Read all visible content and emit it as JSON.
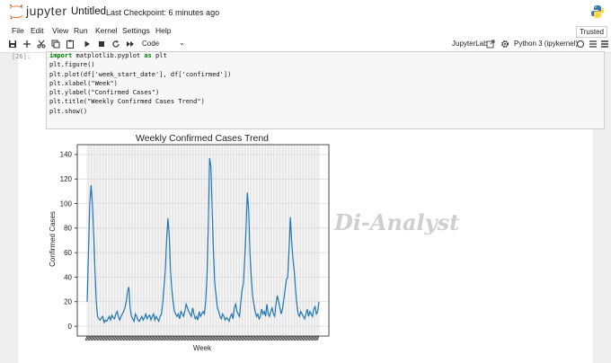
{
  "header": {
    "logo_text": "jupyter",
    "notebook_title": "Untitled",
    "checkpoint": "Last Checkpoint: 6 minutes ago"
  },
  "menu": {
    "items": [
      "File",
      "Edit",
      "View",
      "Run",
      "Kernel",
      "Settings",
      "Help"
    ],
    "trusted": "Trusted"
  },
  "toolbar": {
    "icons": [
      "save-icon",
      "add-cell-icon",
      "cut-icon",
      "copy-icon",
      "paste-icon",
      "run-icon",
      "stop-icon",
      "restart-icon",
      "fast-forward-icon"
    ],
    "cell_type": "Code",
    "jupyterlab_label": "JupyterLab",
    "kernel_name": "Python 3 (ipykernel)"
  },
  "cell": {
    "prompt": "[26]:",
    "code_lines": [
      "import matplotlib.pyplot as plt",
      "",
      "plt.figure()",
      "plt.plot(df['week_start_date'], df['confirmed'])",
      "plt.xlabel(\"Week\")",
      "plt.ylabel(\"Confirmed Cases\")",
      "plt.title(\"Weekly Confirmed Cases Trend\")",
      "plt.show()"
    ]
  },
  "watermark": "Di-Analyst",
  "chart_data": {
    "type": "line",
    "title": "Weekly Confirmed Cases Trend",
    "xlabel": "Week",
    "ylabel": "Confirmed Cases",
    "ylim": [
      -8,
      148
    ],
    "yticks": [
      0,
      20,
      40,
      60,
      80,
      100,
      120,
      140
    ],
    "grid": true,
    "color": "#1f77b4",
    "series": [
      {
        "values": [
          20,
          60,
          100,
          115,
          100,
          75,
          45,
          20,
          8,
          6,
          5,
          7,
          8,
          3,
          5,
          4,
          6,
          8,
          5,
          9,
          7,
          6,
          10,
          12,
          8,
          5,
          8,
          10,
          12,
          15,
          20,
          28,
          32,
          15,
          8,
          6,
          4,
          10,
          8,
          5,
          4,
          6,
          8,
          5,
          7,
          10,
          6,
          8,
          9,
          5,
          8,
          10,
          5,
          8,
          6,
          4,
          8,
          10,
          18,
          32,
          45,
          70,
          88,
          75,
          45,
          30,
          20,
          12,
          10,
          8,
          10,
          6,
          12,
          10,
          8,
          12,
          18,
          15,
          12,
          10,
          8,
          15,
          10,
          6,
          8,
          5,
          12,
          8,
          10,
          12,
          10,
          20,
          40,
          80,
          137,
          130,
          95,
          60,
          35,
          25,
          15,
          12,
          8,
          6,
          10,
          8,
          5,
          7,
          6,
          4,
          8,
          10,
          6,
          15,
          18,
          12,
          10,
          8,
          20,
          30,
          35,
          55,
          80,
          109,
          95,
          60,
          40,
          25,
          18,
          12,
          8,
          10,
          6,
          8,
          14,
          10,
          12,
          8,
          18,
          10,
          8,
          12,
          15,
          10,
          8,
          18,
          25,
          20,
          15,
          10,
          14,
          22,
          30,
          38,
          40,
          62,
          89,
          70,
          55,
          45,
          30,
          18,
          10,
          8,
          12,
          10,
          8,
          6,
          10,
          14,
          8,
          12,
          10,
          8,
          14,
          16,
          10,
          12,
          20
        ]
      }
    ]
  }
}
